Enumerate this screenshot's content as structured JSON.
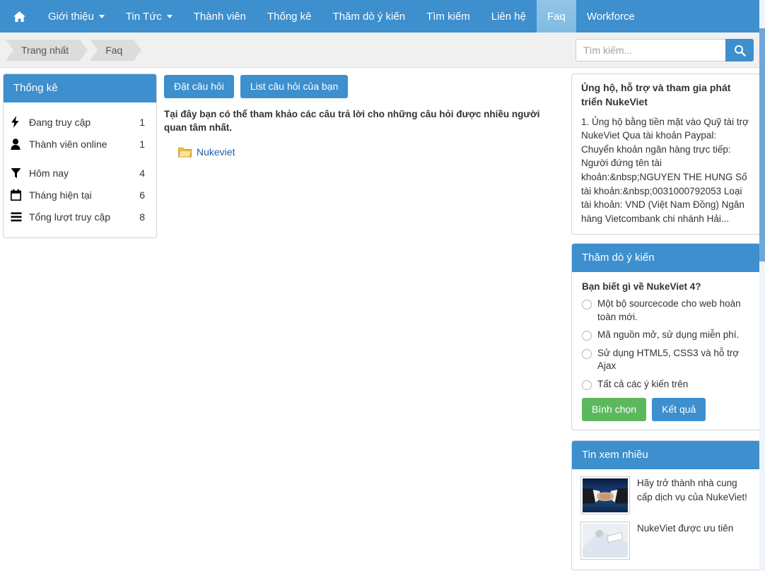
{
  "nav": {
    "home_icon": "home-icon",
    "items": [
      {
        "label": "Giới thiệu",
        "caret": true,
        "active": false
      },
      {
        "label": "Tin Tức",
        "caret": true,
        "active": false
      },
      {
        "label": "Thành viên",
        "caret": false,
        "active": false
      },
      {
        "label": "Thống kê",
        "caret": false,
        "active": false
      },
      {
        "label": "Thăm dò ý kiến",
        "caret": false,
        "active": false
      },
      {
        "label": "Tìm kiếm",
        "caret": false,
        "active": false
      },
      {
        "label": "Liên hệ",
        "caret": false,
        "active": false
      },
      {
        "label": "Faq",
        "caret": false,
        "active": true
      },
      {
        "label": "Workforce",
        "caret": false,
        "active": false
      }
    ]
  },
  "breadcrumb": {
    "items": [
      {
        "label": "Trang nhất"
      },
      {
        "label": "Faq"
      }
    ]
  },
  "search": {
    "placeholder": "Tìm kiếm...",
    "value": "",
    "button_icon": "search-icon"
  },
  "stats": {
    "title": "Thống kê",
    "rows": [
      {
        "icon": "bolt-icon",
        "label": "Đang truy cập",
        "value": "1",
        "gap": false
      },
      {
        "icon": "user-icon",
        "label": "Thành viên online",
        "value": "1",
        "gap": false
      },
      {
        "icon": "funnel-icon",
        "label": "Hôm nay",
        "value": "4",
        "gap": true
      },
      {
        "icon": "calendar-icon",
        "label": "Tháng hiện tại",
        "value": "6",
        "gap": false
      },
      {
        "icon": "bars-icon",
        "label": "Tổng lượt truy cập",
        "value": "8",
        "gap": false
      }
    ]
  },
  "main": {
    "ask_button": "Đặt câu hỏi",
    "list_button": "List câu hỏi của bạn",
    "intro": "Tại đây bạn có thể tham khảo các câu trả lời cho những câu hỏi được nhiều người quan tâm nhất.",
    "folders": [
      {
        "icon": "folder-icon",
        "label": "Nukeviet"
      }
    ]
  },
  "support": {
    "title": "Ủng hộ, hỗ trợ và tham gia phát triển NukeViet",
    "body": "1. Ủng hộ bằng tiền mặt vào Quỹ tài trợ NukeViet Qua tài khoản Paypal: Chuyển khoản ngân hàng trực tiếp: Người đứng tên tài khoản:&nbsp;NGUYEN THE HUNG Số tài khoản:&nbsp;0031000792053 Loại tài khoản: VND (Việt Nam Đồng) Ngân hàng Vietcombank chi nhánh Hải..."
  },
  "poll": {
    "title": "Thăm dò ý kiến",
    "question": "Bạn biết gì về NukeViet 4?",
    "options": [
      {
        "label": "Một bộ sourcecode cho web hoàn toàn mới."
      },
      {
        "label": "Mã nguồn mở, sử dụng miễn phí."
      },
      {
        "label": "Sử dụng HTML5, CSS3 và hỗ trợ Ajax"
      },
      {
        "label": "Tất cả các ý kiến trên"
      }
    ],
    "vote_button": "Bình chọn",
    "result_button": "Kết quả"
  },
  "news": {
    "title": "Tin xem nhiều",
    "items": [
      {
        "title": "Hãy trở thành nhà cung cấp dịch vụ của NukeViet!",
        "thumb": "handshake-photo"
      },
      {
        "title": "NukeViet được ưu tiên",
        "thumb": "document-photo"
      }
    ]
  },
  "colors": {
    "brand_blue": "#3d8fce",
    "active_tab": "#8cc0e4",
    "green": "#5cb85c",
    "link_blue": "#1f5fa8",
    "panel_border": "#d4d4d4",
    "crumb_bg": "#dcdcdc",
    "strip_bg": "#f0f0f0"
  }
}
